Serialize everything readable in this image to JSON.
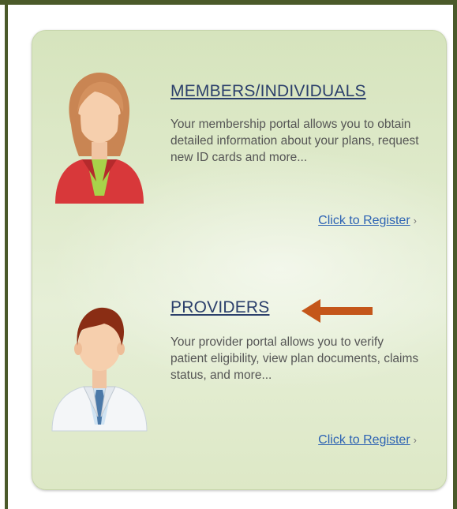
{
  "colors": {
    "frame": "#4b5a2a",
    "title": "#2b3f6b",
    "link": "#2c62b3",
    "body_text": "#555555",
    "arrow": "#c4561a",
    "panel": "#dfeacb"
  },
  "members": {
    "title": "MEMBERS/INDIVIDUALS",
    "description": "Your membership portal allows you to obtain detailed information about your plans, request new ID cards and more...",
    "register_label": "Click to Register",
    "icon": "woman-avatar-icon"
  },
  "providers": {
    "title": "PROVIDERS",
    "description": "Your provider portal allows you to verify patient eligibility, view plan documents, claims status, and more...",
    "register_label": "Click to Register",
    "icon": "doctor-avatar-icon"
  },
  "annotation": {
    "icon": "left-arrow-icon"
  }
}
